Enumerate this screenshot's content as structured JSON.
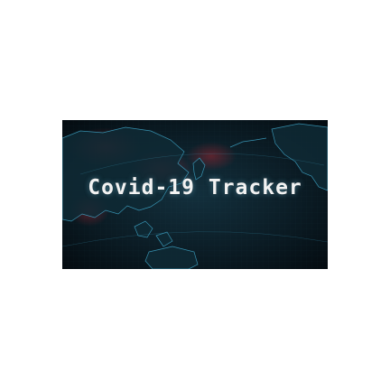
{
  "banner": {
    "title": "Covid-19 Tracker",
    "image": "dark-world-map-background",
    "colors": {
      "background": "#0a1a22",
      "map_outline": "#3fa6c8",
      "hotspot": "#8a1f2a",
      "text": "#f2f2f2"
    }
  }
}
